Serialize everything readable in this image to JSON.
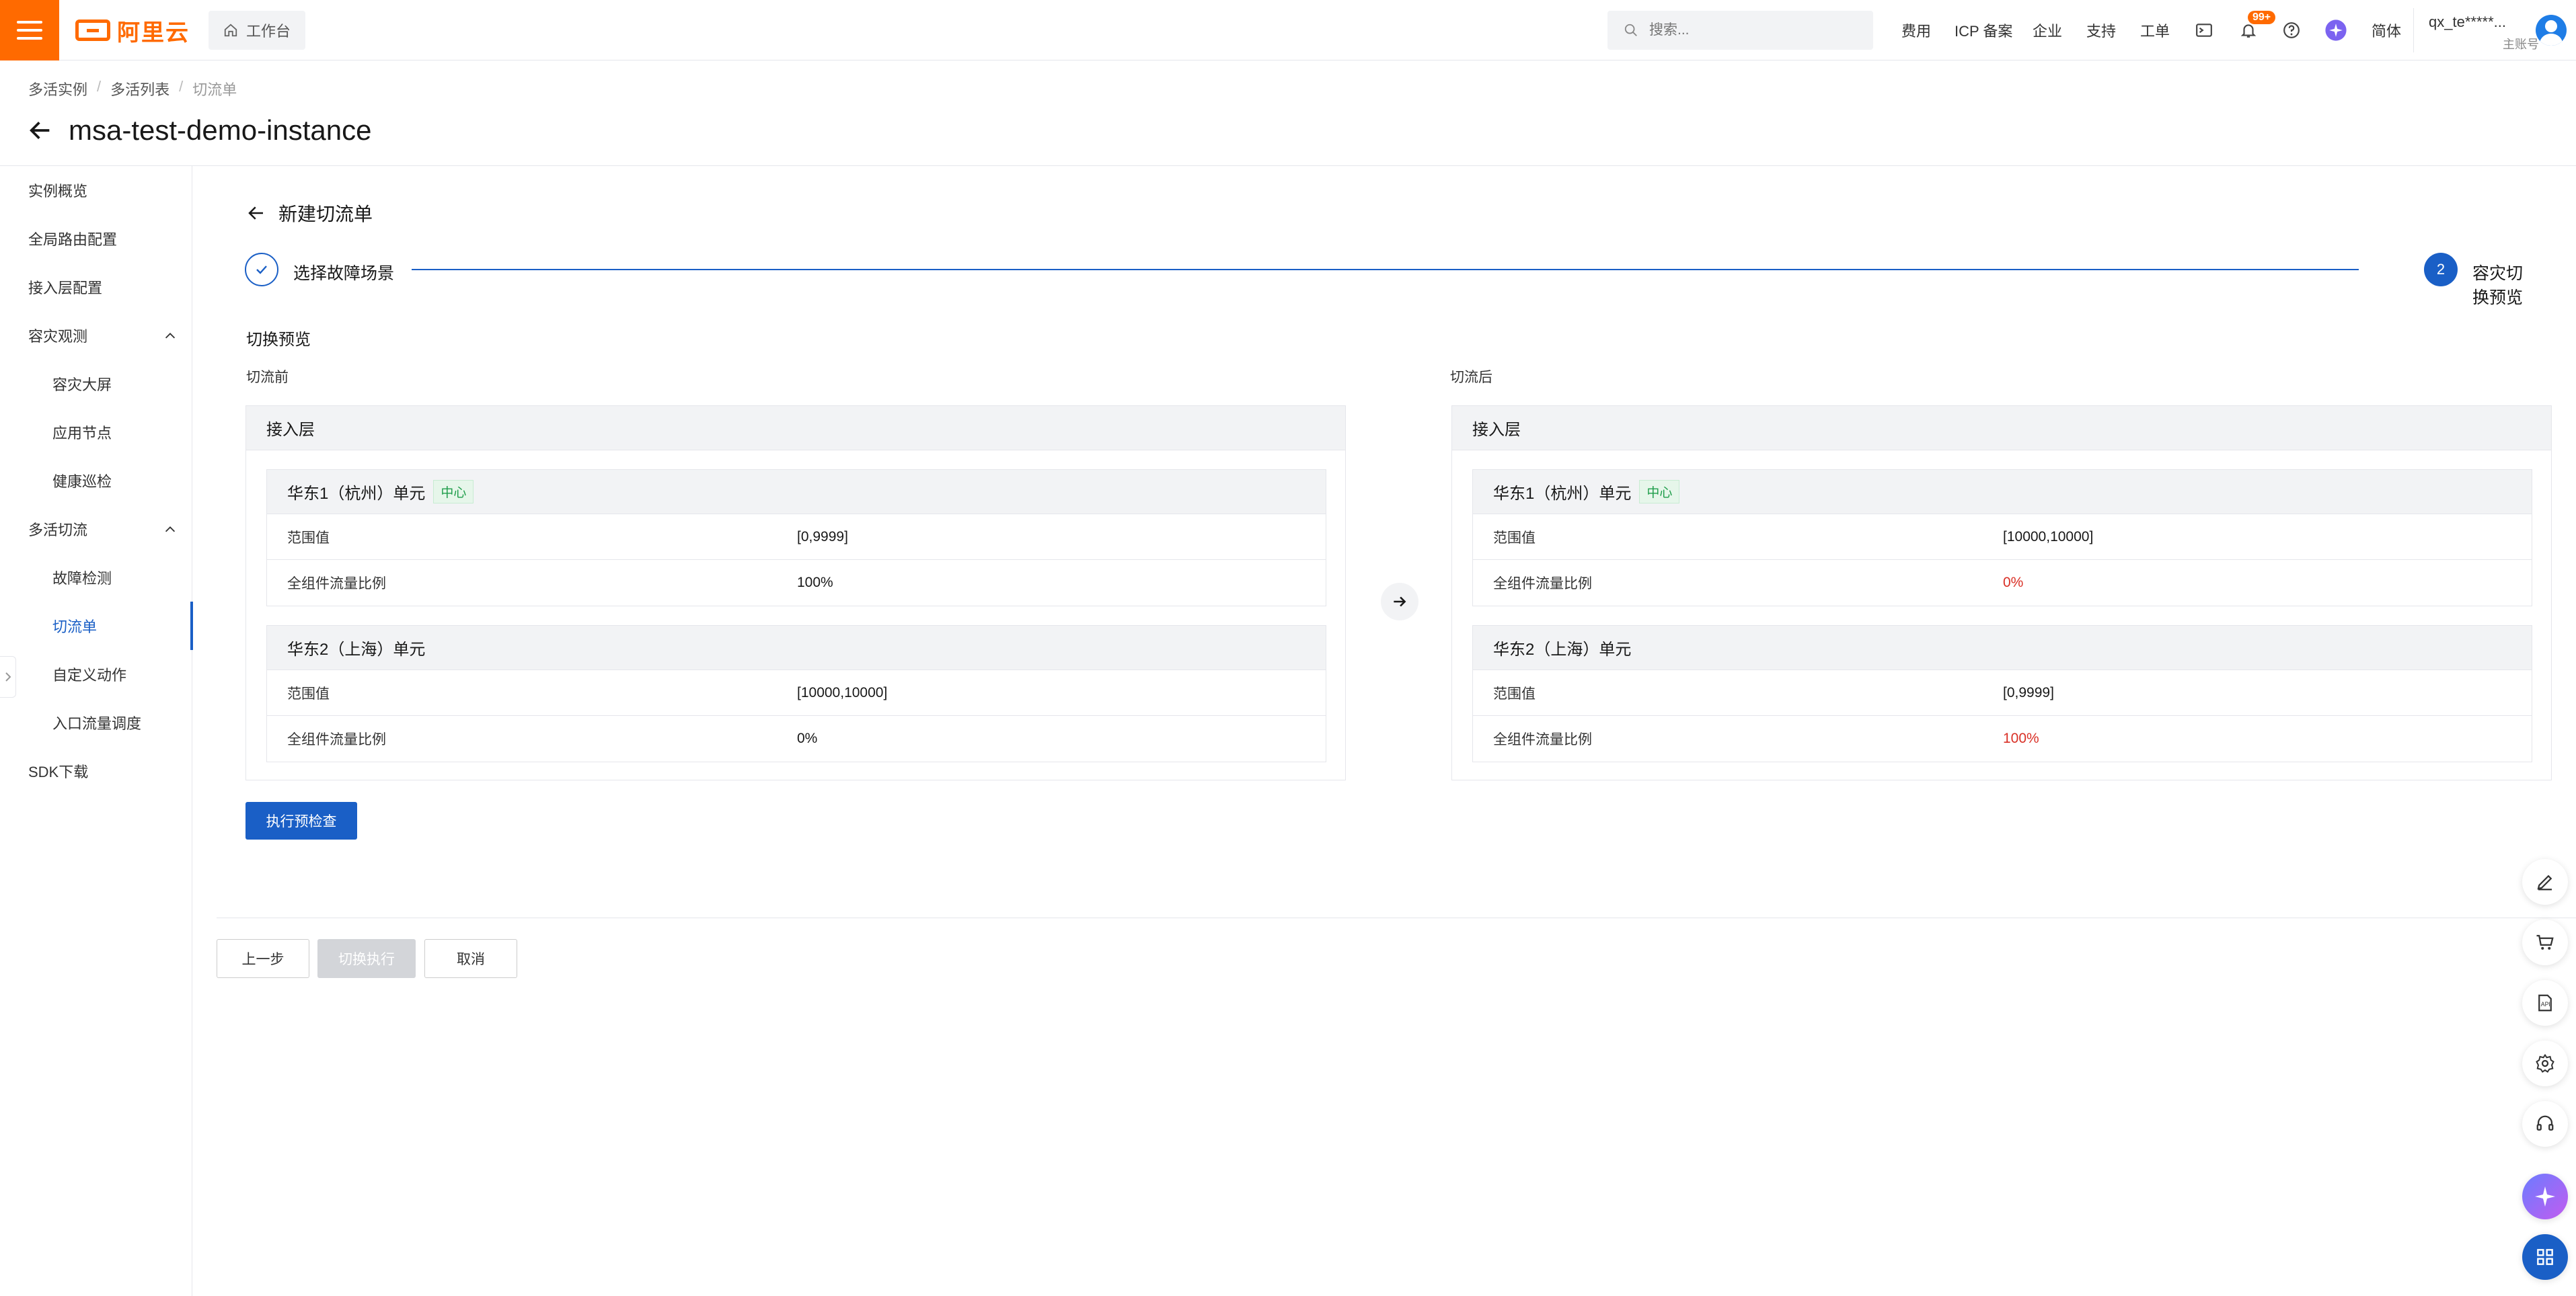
{
  "topbar": {
    "logo": "阿里云",
    "workbench": "工作台",
    "search_placeholder": "搜索...",
    "nav": [
      "费用",
      "ICP 备案",
      "企业",
      "支持",
      "工单"
    ],
    "notif_badge": "99+",
    "lang": "简体",
    "user_name": "qx_te*****...",
    "user_role": "主账号"
  },
  "breadcrumb": [
    "多活实例",
    "多活列表",
    "切流单"
  ],
  "page_title": "msa-test-demo-instance",
  "sidebar": {
    "items": [
      {
        "label": "实例概览"
      },
      {
        "label": "全局路由配置"
      },
      {
        "label": "接入层配置"
      },
      {
        "label": "容灾观测"
      },
      {
        "label": "容灾大屏"
      },
      {
        "label": "应用节点"
      },
      {
        "label": "健康巡检"
      },
      {
        "label": "多活切流"
      },
      {
        "label": "故障检测"
      },
      {
        "label": "切流单"
      },
      {
        "label": "自定义动作"
      },
      {
        "label": "入口流量调度"
      },
      {
        "label": "SDK下载"
      }
    ]
  },
  "form": {
    "title": "新建切流单",
    "steps": [
      {
        "label": "选择故障场景",
        "status": "done"
      },
      {
        "number": "2",
        "label": "容灾切换预览",
        "status": "current"
      }
    ],
    "section_title": "切换预览",
    "before_label": "切流前",
    "after_label": "切流后",
    "before": {
      "layer": "接入层",
      "units": [
        {
          "name": "华东1（杭州）单元",
          "tag": "中心",
          "rows": [
            {
              "key": "范围值",
              "value": "[0,9999]"
            },
            {
              "key": "全组件流量比例",
              "value": "100%"
            }
          ]
        },
        {
          "name": "华东2（上海）单元",
          "tag": "",
          "rows": [
            {
              "key": "范围值",
              "value": "[10000,10000]"
            },
            {
              "key": "全组件流量比例",
              "value": "0%"
            }
          ]
        }
      ]
    },
    "after": {
      "layer": "接入层",
      "units": [
        {
          "name": "华东1（杭州）单元",
          "tag": "中心",
          "rows": [
            {
              "key": "范围值",
              "value": "[10000,10000]"
            },
            {
              "key": "全组件流量比例",
              "value": "0%"
            }
          ]
        },
        {
          "name": "华东2（上海）单元",
          "tag": "",
          "rows": [
            {
              "key": "范围值",
              "value": "[0,9999]"
            },
            {
              "key": "全组件流量比例",
              "value": "100%"
            }
          ]
        }
      ]
    },
    "precheck_button": "执行预检查"
  },
  "footer": {
    "prev_button": "上一步",
    "execute_button": "切换执行",
    "cancel_button": "取消"
  },
  "colors": {
    "brand": "#ff6a00",
    "primary": "#1a5fc6",
    "changed_value": "#d93026",
    "center_tag": "#1e9d4a"
  }
}
